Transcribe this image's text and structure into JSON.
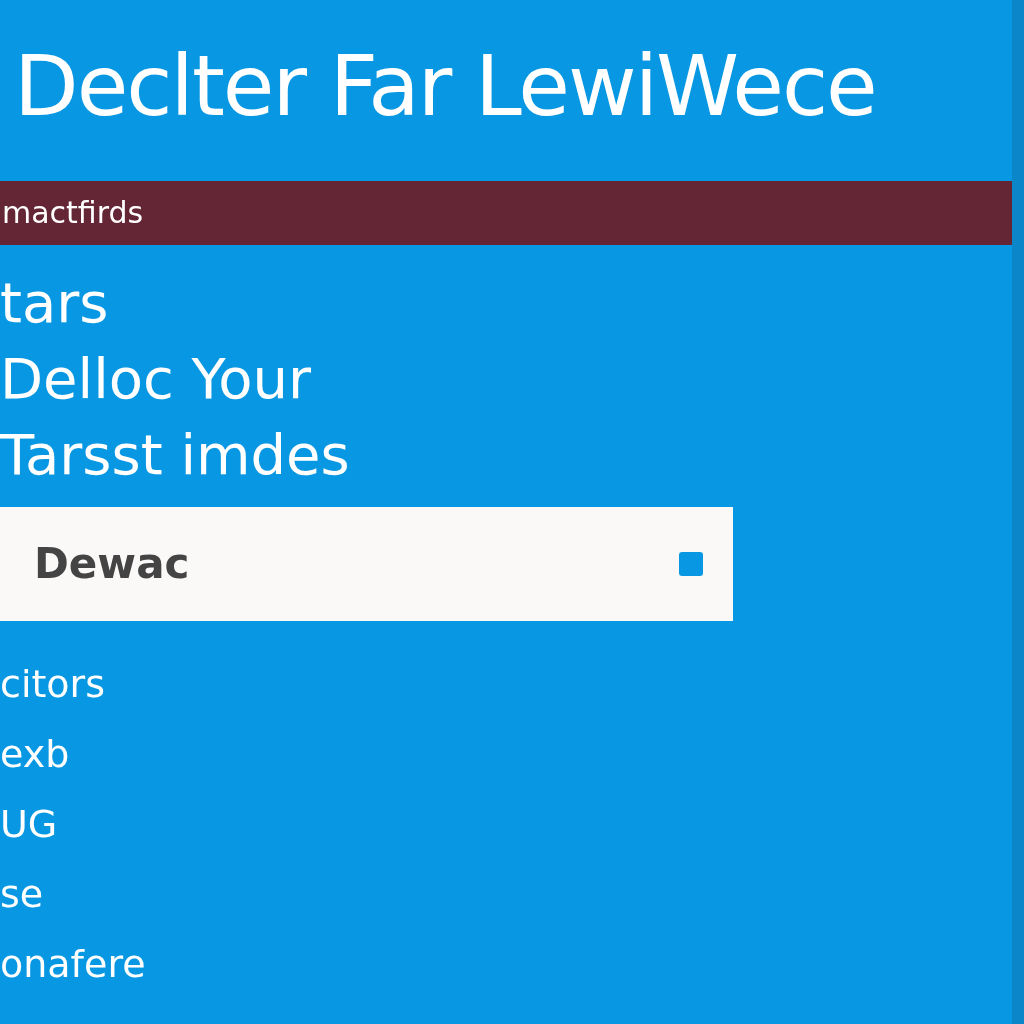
{
  "title": "Declter Far LewiWece",
  "banner": "mactfirds",
  "headings": [
    "tars",
    "Delloc Your",
    "Tarsst imdes"
  ],
  "field": {
    "value": "Dewac"
  },
  "items": [
    "citors",
    "exb",
    "UG",
    "se",
    "onafere"
  ]
}
